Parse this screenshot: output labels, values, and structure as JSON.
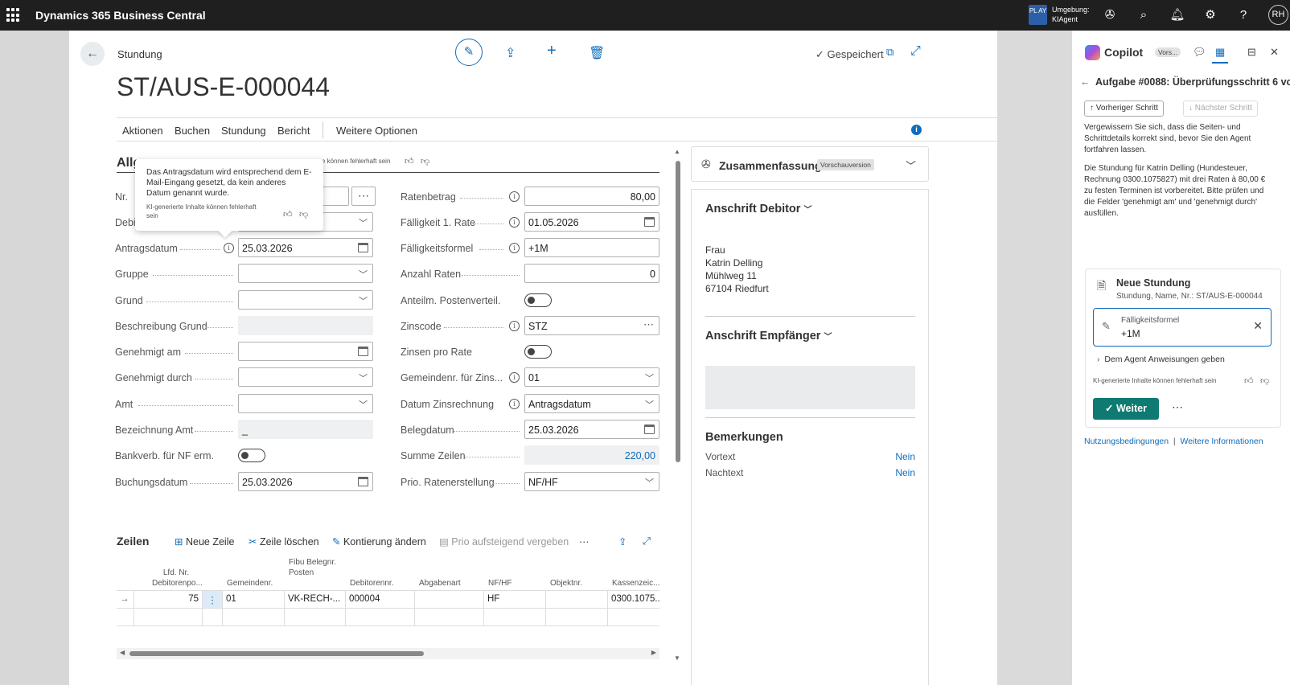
{
  "topbar": {
    "app_name": "Dynamics 365 Business Central",
    "env_badge": "PL AY",
    "env_line1": "Umgebung:",
    "env_line2": "KIAgent",
    "avatar": "RH",
    "icons": [
      "copilot-icon",
      "search-icon",
      "bell-icon",
      "gear-icon",
      "help-icon"
    ]
  },
  "page": {
    "breadcrumb": "Stundung",
    "title": "ST/AUS-E-000044",
    "saved": "Gespeichert"
  },
  "menu": {
    "items": [
      "Aktionen",
      "Buchen",
      "Stundung",
      "Bericht"
    ],
    "more": "Weitere Optionen"
  },
  "section": {
    "title": "Allg",
    "ai_note": "e können fehlerhaft sein"
  },
  "tooltip": {
    "text": "Das Antragsdatum wird entsprechend dem E-Mail-Eingang gesetzt, da kein anderes Datum genannt wurde.",
    "note": "KI-generierte Inhalte können fehlerhaft sein"
  },
  "left_fields": [
    {
      "label": "Nr.",
      "value": ""
    },
    {
      "label": "Debi",
      "value": ""
    },
    {
      "label": "Antragsdatum",
      "value": "25.03.2026"
    },
    {
      "label": "Gruppe",
      "value": ""
    },
    {
      "label": "Grund",
      "value": ""
    },
    {
      "label": "Beschreibung Grund",
      "value": ""
    },
    {
      "label": "Genehmigt am",
      "value": ""
    },
    {
      "label": "Genehmigt durch",
      "value": ""
    },
    {
      "label": "Amt",
      "value": ""
    },
    {
      "label": "Bezeichnung Amt",
      "value": "_"
    },
    {
      "label": "Bankverb. für NF erm.",
      "value": ""
    },
    {
      "label": "Buchungsdatum",
      "value": "25.03.2026"
    }
  ],
  "right_fields": [
    {
      "label": "Ratenbetrag",
      "value": "80,00"
    },
    {
      "label": "Fälligkeit 1. Rate",
      "value": "01.05.2026"
    },
    {
      "label": "Fälligkeitsformel",
      "value": "+1M"
    },
    {
      "label": "Anzahl Raten",
      "value": "0"
    },
    {
      "label": "Anteilm. Postenverteil.",
      "value": ""
    },
    {
      "label": "Zinscode",
      "value": "STZ"
    },
    {
      "label": "Zinsen pro Rate",
      "value": ""
    },
    {
      "label": "Gemeindenr. für Zins...",
      "value": "01"
    },
    {
      "label": "Datum Zinsrechnung",
      "value": "Antragsdatum"
    },
    {
      "label": "Belegdatum",
      "value": "25.03.2026"
    },
    {
      "label": "Summe Zeilen",
      "value": "220,00"
    },
    {
      "label": "Prio. Ratenerstellung",
      "value": "NF/HF"
    }
  ],
  "summary": {
    "title": "Zusammenfassung",
    "badge": "Vorschauversion"
  },
  "factbox": {
    "debitor_title": "Anschrift Debitor",
    "address": [
      "Frau",
      "Katrin Delling",
      "Mühlweg 11",
      "67104 Riedfurt"
    ],
    "empfaenger_title": "Anschrift Empfänger",
    "remarks_title": "Bemerkungen",
    "remarks": [
      {
        "label": "Vortext",
        "value": "Nein"
      },
      {
        "label": "Nachtext",
        "value": "Nein"
      }
    ]
  },
  "lines": {
    "title": "Zeilen",
    "actions": [
      "Neue Zeile",
      "Zeile löschen",
      "Kontierung ändern",
      "Prio aufsteigend vergeben"
    ],
    "headers": [
      "Lfd. Nr. Debitorenpo...",
      "Gemeindenr.",
      "Fibu Belegnr. Posten",
      "Debitorennr.",
      "Abgabenart",
      "NF/HF",
      "Objektnr.",
      "Kassenzeic..."
    ],
    "row": [
      "75",
      "01",
      "VK-RECH-...",
      "000004",
      "",
      "HF",
      "",
      "0300.1075..."
    ]
  },
  "copilot": {
    "title": "Copilot",
    "version": "Vors...",
    "task": "Aufgabe #0088: Überprüfungsschritt 6 vo...",
    "prev": "Vorheriger Schritt",
    "next": "Nächster Schritt",
    "text1": "Vergewissern Sie sich, dass die Seiten- und Schrittdetails korrekt sind, bevor Sie den Agent fortfahren lassen.",
    "text2": "Die Stundung für Katrin Delling (Hundesteuer, Rechnung 0300.1075827) mit drei Raten à 80,00 € zu festen Terminen ist vorbereitet. Bitte prüfen und die Felder 'genehmigt am' und 'genehmigt durch' ausfüllen.",
    "card_title": "Neue Stundung",
    "card_sub": "Stundung, Name, Nr.: ST/AUS-E-000044",
    "field_label": "Fälligkeitsformel",
    "field_value": "+1M",
    "instructions": "Dem Agent Anweisungen geben",
    "ai_note": "KI-generierte Inhalte können fehlerhaft sein",
    "continue": "Weiter",
    "link1": "Nutzungsbedingungen",
    "link2": "Weitere Informationen"
  }
}
